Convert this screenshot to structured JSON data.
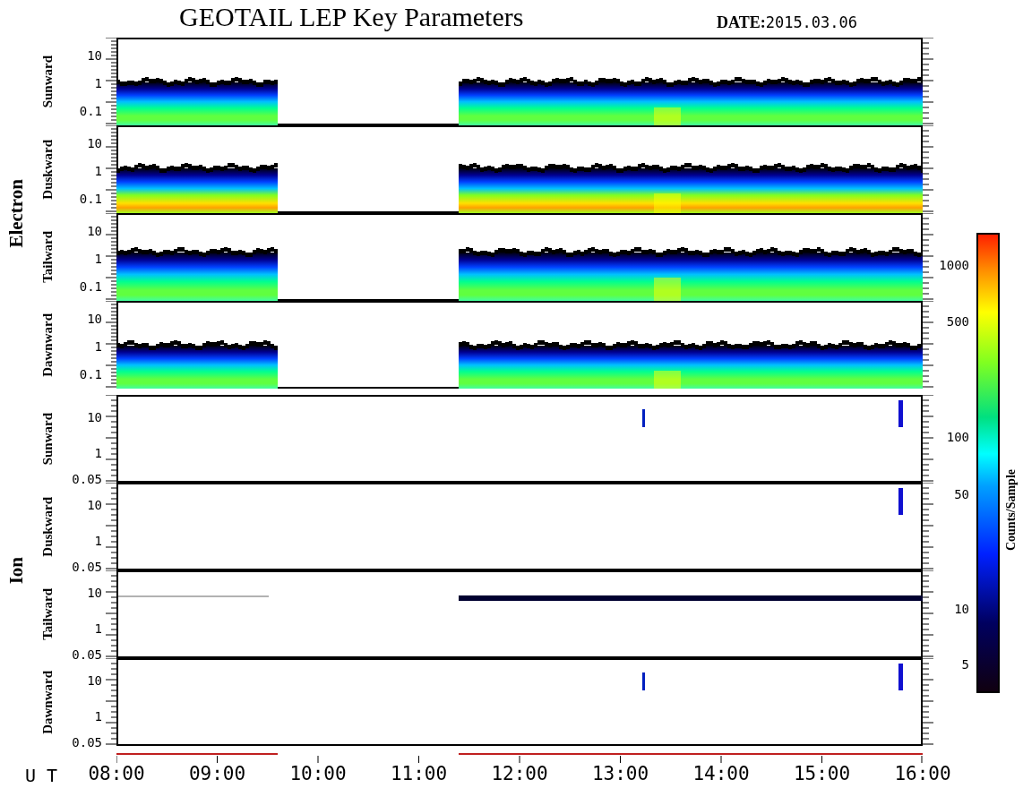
{
  "title": "GEOTAIL LEP Key Parameters",
  "date": {
    "label": "DATE:",
    "value": "2015.03.06"
  },
  "groups": [
    {
      "name": "Electron",
      "kind": "electron",
      "panels": [
        {
          "label": "Sunward",
          "yticks": [
            "10",
            "1",
            "0.1"
          ]
        },
        {
          "label": "Duskward",
          "yticks": [
            "10",
            "1",
            "0.1"
          ]
        },
        {
          "label": "Tailward",
          "yticks": [
            "10",
            "1",
            "0.1"
          ]
        },
        {
          "label": "Dawnward",
          "yticks": [
            "10",
            "1",
            "0.1"
          ]
        }
      ]
    },
    {
      "name": "Ion",
      "kind": "ion",
      "panels": [
        {
          "label": "Sunward",
          "yticks": [
            "10",
            "1",
            "0.05"
          ]
        },
        {
          "label": "Duskward",
          "yticks": [
            "10",
            "1",
            "0.05"
          ]
        },
        {
          "label": "Tailward",
          "yticks": [
            "10",
            "1",
            "0.05"
          ]
        },
        {
          "label": "Dawnward",
          "yticks": [
            "10",
            "1",
            "0.05"
          ]
        }
      ]
    }
  ],
  "x_axis": {
    "label": "U T",
    "ticks": [
      "08:00",
      "09:00",
      "10:00",
      "11:00",
      "12:00",
      "13:00",
      "14:00",
      "15:00",
      "16:00"
    ]
  },
  "colorbar": {
    "label": "Counts/Sample",
    "ticks": [
      "1000",
      "500",
      "100",
      "50",
      "10",
      "5"
    ]
  }
}
